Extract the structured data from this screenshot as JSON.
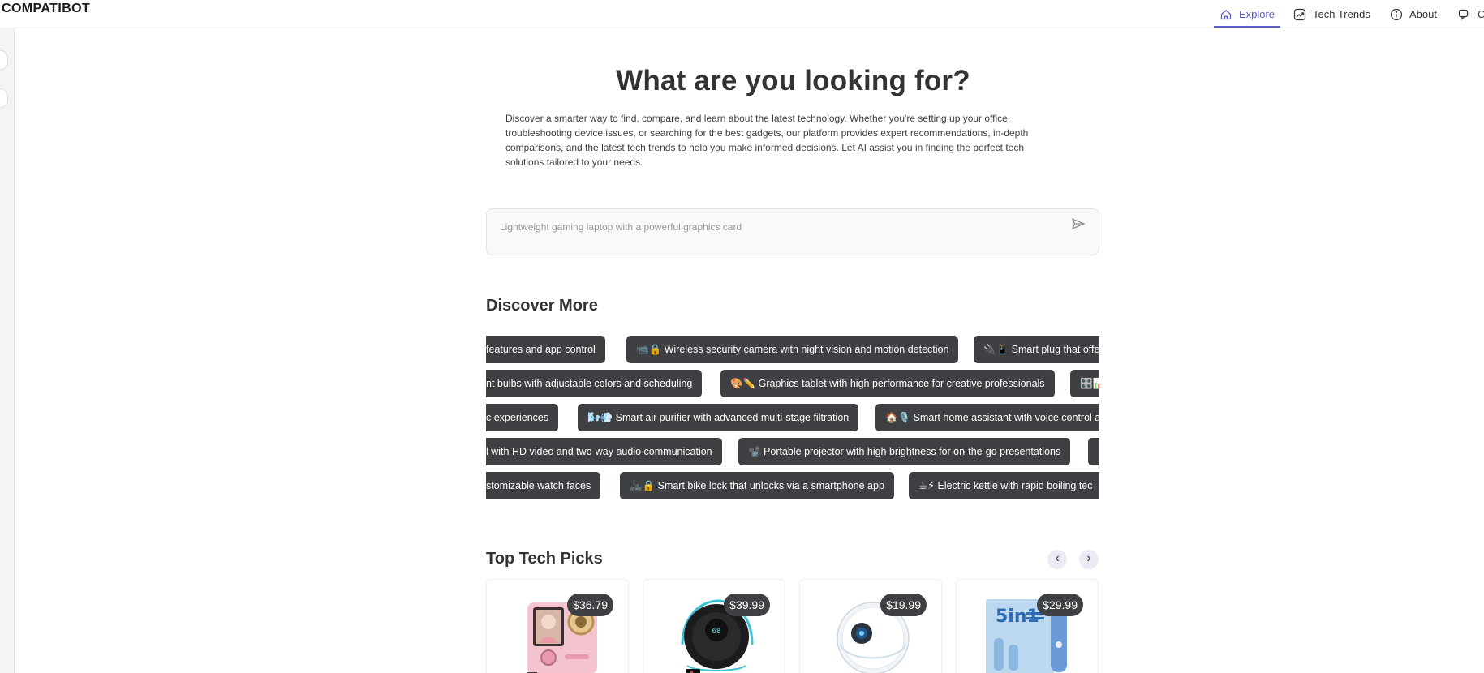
{
  "brand": {
    "logo_text": "COMPATIBOT"
  },
  "nav": {
    "items": [
      {
        "label": "Explore",
        "icon": "home-icon",
        "active": true
      },
      {
        "label": "Tech Trends",
        "icon": "trend-chart-icon",
        "active": false
      },
      {
        "label": "About",
        "icon": "info-icon",
        "active": false
      },
      {
        "label": "C",
        "icon": "chat-icon",
        "active": false
      }
    ],
    "accent_color": "#5b5fc7"
  },
  "hero": {
    "title": "What are you looking for?",
    "description": "Discover a smarter way to find, compare, and learn about the latest technology. Whether you're setting up your office, troubleshooting device issues, or searching for the best gadgets, our platform provides expert recommendations, in-depth comparisons, and the latest tech trends to help you make informed decisions. Let AI assist you in finding the perfect tech solutions tailored to your needs."
  },
  "search": {
    "placeholder": "Lightweight gaming laptop with a powerful graphics card",
    "value": "",
    "send_icon": "send-icon"
  },
  "discover": {
    "title": "Discover More",
    "rows": [
      [
        {
          "text": "features and app control"
        },
        {
          "text": "📹🔒 Wireless security camera with night vision and motion detection"
        },
        {
          "text": "🔌📱 Smart plug that offers"
        }
      ],
      [
        {
          "text": "nt bulbs with adjustable colors and scheduling"
        },
        {
          "text": "🎨✏️ Graphics tablet with high performance for creative professionals"
        },
        {
          "text": "🎛️📊"
        }
      ],
      [
        {
          "text": "c experiences"
        },
        {
          "text": "🌬️💨 Smart air purifier with advanced multi-stage filtration"
        },
        {
          "text": "🏠🎙️ Smart home assistant with voice control ar"
        }
      ],
      [
        {
          "text": "l with HD video and two-way audio communication"
        },
        {
          "text": "📽️ Portable projector with high brightness for on-the-go presentations"
        },
        {
          "text": ""
        }
      ],
      [
        {
          "text": "stomizable watch faces"
        },
        {
          "text": "🚲🔒 Smart bike lock that unlocks via a smartphone app"
        },
        {
          "text": "☕⚡ Electric kettle with rapid boiling tec"
        }
      ]
    ]
  },
  "picks": {
    "title": "Top Tech Picks",
    "prev_label": "‹",
    "next_label": "›",
    "cards": [
      {
        "price": "$36.79",
        "image": "pink-kids-camera"
      },
      {
        "price": "$39.99",
        "image": "black-smart-fan"
      },
      {
        "price": "$19.99",
        "image": "white-round-device"
      },
      {
        "price": "$29.99",
        "image": "5in1-grooming-kit"
      }
    ]
  }
}
